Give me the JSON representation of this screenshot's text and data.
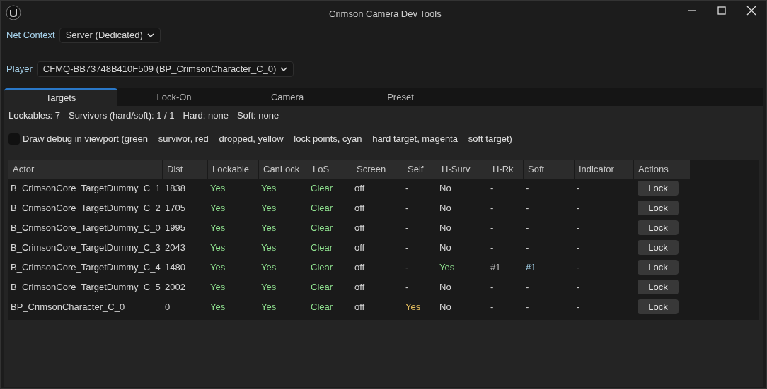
{
  "window": {
    "title": "Crimson Camera Dev Tools"
  },
  "net_context": {
    "label": "Net Context",
    "value": "Server (Dedicated)"
  },
  "player": {
    "label": "Player",
    "value": "CFMQ-BB73748B410F509 (BP_CrimsonCharacter_C_0)"
  },
  "tabs": [
    {
      "label": "Targets",
      "selected": true
    },
    {
      "label": "Lock-On",
      "selected": false
    },
    {
      "label": "Camera",
      "selected": false
    },
    {
      "label": "Preset",
      "selected": false
    }
  ],
  "summary": [
    "Lockables: 7",
    "Survivors (hard/soft): 1 / 1",
    "Hard: none",
    "Soft: none"
  ],
  "debug_option": {
    "label": "Draw debug in viewport (green = survivor, red = dropped, yellow = lock points, cyan = hard target, magenta = soft target)",
    "checked": false
  },
  "table": {
    "columns": [
      "Actor",
      "Dist",
      "Lockable",
      "CanLock",
      "LoS",
      "Screen",
      "Self",
      "H-Surv",
      "H-Rk",
      "Soft",
      "Indicator",
      "Actions"
    ],
    "rows": [
      {
        "cells": [
          {
            "text": "B_CrimsonCore_TargetDummy_C_1",
            "kind": "plain"
          },
          {
            "text": "1838",
            "kind": "plain"
          },
          {
            "text": "Yes",
            "kind": "good"
          },
          {
            "text": "Yes",
            "kind": "good"
          },
          {
            "text": "Clear",
            "kind": "good"
          },
          {
            "text": "off",
            "kind": "plain"
          },
          {
            "text": "-",
            "kind": "plain"
          },
          {
            "text": "No",
            "kind": "plain"
          },
          {
            "text": "-",
            "kind": "plain"
          },
          {
            "text": "-",
            "kind": "plain"
          },
          {
            "text": "-",
            "kind": "plain"
          }
        ],
        "action": "Lock"
      },
      {
        "cells": [
          {
            "text": "B_CrimsonCore_TargetDummy_C_2",
            "kind": "plain"
          },
          {
            "text": "1705",
            "kind": "plain"
          },
          {
            "text": "Yes",
            "kind": "good"
          },
          {
            "text": "Yes",
            "kind": "good"
          },
          {
            "text": "Clear",
            "kind": "good"
          },
          {
            "text": "off",
            "kind": "plain"
          },
          {
            "text": "-",
            "kind": "plain"
          },
          {
            "text": "No",
            "kind": "plain"
          },
          {
            "text": "-",
            "kind": "plain"
          },
          {
            "text": "-",
            "kind": "plain"
          },
          {
            "text": "-",
            "kind": "plain"
          }
        ],
        "action": "Lock"
      },
      {
        "cells": [
          {
            "text": "B_CrimsonCore_TargetDummy_C_0",
            "kind": "plain"
          },
          {
            "text": "1995",
            "kind": "plain"
          },
          {
            "text": "Yes",
            "kind": "good"
          },
          {
            "text": "Yes",
            "kind": "good"
          },
          {
            "text": "Clear",
            "kind": "good"
          },
          {
            "text": "off",
            "kind": "plain"
          },
          {
            "text": "-",
            "kind": "plain"
          },
          {
            "text": "No",
            "kind": "plain"
          },
          {
            "text": "-",
            "kind": "plain"
          },
          {
            "text": "-",
            "kind": "plain"
          },
          {
            "text": "-",
            "kind": "plain"
          }
        ],
        "action": "Lock"
      },
      {
        "cells": [
          {
            "text": "B_CrimsonCore_TargetDummy_C_3",
            "kind": "plain"
          },
          {
            "text": "2043",
            "kind": "plain"
          },
          {
            "text": "Yes",
            "kind": "good"
          },
          {
            "text": "Yes",
            "kind": "good"
          },
          {
            "text": "Clear",
            "kind": "good"
          },
          {
            "text": "off",
            "kind": "plain"
          },
          {
            "text": "-",
            "kind": "plain"
          },
          {
            "text": "No",
            "kind": "plain"
          },
          {
            "text": "-",
            "kind": "plain"
          },
          {
            "text": "-",
            "kind": "plain"
          },
          {
            "text": "-",
            "kind": "plain"
          }
        ],
        "action": "Lock"
      },
      {
        "cells": [
          {
            "text": "B_CrimsonCore_TargetDummy_C_4",
            "kind": "plain"
          },
          {
            "text": "1480",
            "kind": "plain"
          },
          {
            "text": "Yes",
            "kind": "good"
          },
          {
            "text": "Yes",
            "kind": "good"
          },
          {
            "text": "Clear",
            "kind": "good"
          },
          {
            "text": "off",
            "kind": "plain"
          },
          {
            "text": "-",
            "kind": "plain"
          },
          {
            "text": "Yes",
            "kind": "good"
          },
          {
            "text": "#1",
            "kind": "muted"
          },
          {
            "text": "#1",
            "kind": "soft"
          },
          {
            "text": "-",
            "kind": "plain"
          }
        ],
        "action": "Lock"
      },
      {
        "cells": [
          {
            "text": "B_CrimsonCore_TargetDummy_C_5",
            "kind": "plain"
          },
          {
            "text": "2002",
            "kind": "plain"
          },
          {
            "text": "Yes",
            "kind": "good"
          },
          {
            "text": "Yes",
            "kind": "good"
          },
          {
            "text": "Clear",
            "kind": "good"
          },
          {
            "text": "off",
            "kind": "plain"
          },
          {
            "text": "-",
            "kind": "plain"
          },
          {
            "text": "No",
            "kind": "plain"
          },
          {
            "text": "-",
            "kind": "plain"
          },
          {
            "text": "-",
            "kind": "plain"
          },
          {
            "text": "-",
            "kind": "plain"
          }
        ],
        "action": "Lock"
      },
      {
        "cells": [
          {
            "text": "BP_CrimsonCharacter_C_0",
            "kind": "plain"
          },
          {
            "text": "0",
            "kind": "plain"
          },
          {
            "text": "Yes",
            "kind": "good"
          },
          {
            "text": "Yes",
            "kind": "good"
          },
          {
            "text": "Clear",
            "kind": "good"
          },
          {
            "text": "off",
            "kind": "plain"
          },
          {
            "text": "Yes",
            "kind": "self"
          },
          {
            "text": "No",
            "kind": "plain"
          },
          {
            "text": "-",
            "kind": "plain"
          },
          {
            "text": "-",
            "kind": "plain"
          },
          {
            "text": "-",
            "kind": "plain"
          }
        ],
        "action": "Lock"
      }
    ]
  }
}
